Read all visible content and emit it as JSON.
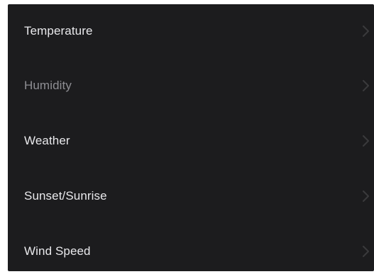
{
  "menu": {
    "items": [
      {
        "label": "Temperature",
        "icon": "chevron-right-icon"
      },
      {
        "label": "Humidity",
        "icon": "chevron-right-icon"
      },
      {
        "label": "Weather",
        "icon": "chevron-right-icon"
      },
      {
        "label": "Sunset/Sunrise",
        "icon": "chevron-right-icon"
      },
      {
        "label": "Wind Speed",
        "icon": "chevron-right-icon"
      }
    ]
  },
  "colors": {
    "background": "#1c1c1e",
    "label": "#e9e9ec",
    "label_dim": "#8e8e93",
    "chevron": "#3a3a3c"
  }
}
